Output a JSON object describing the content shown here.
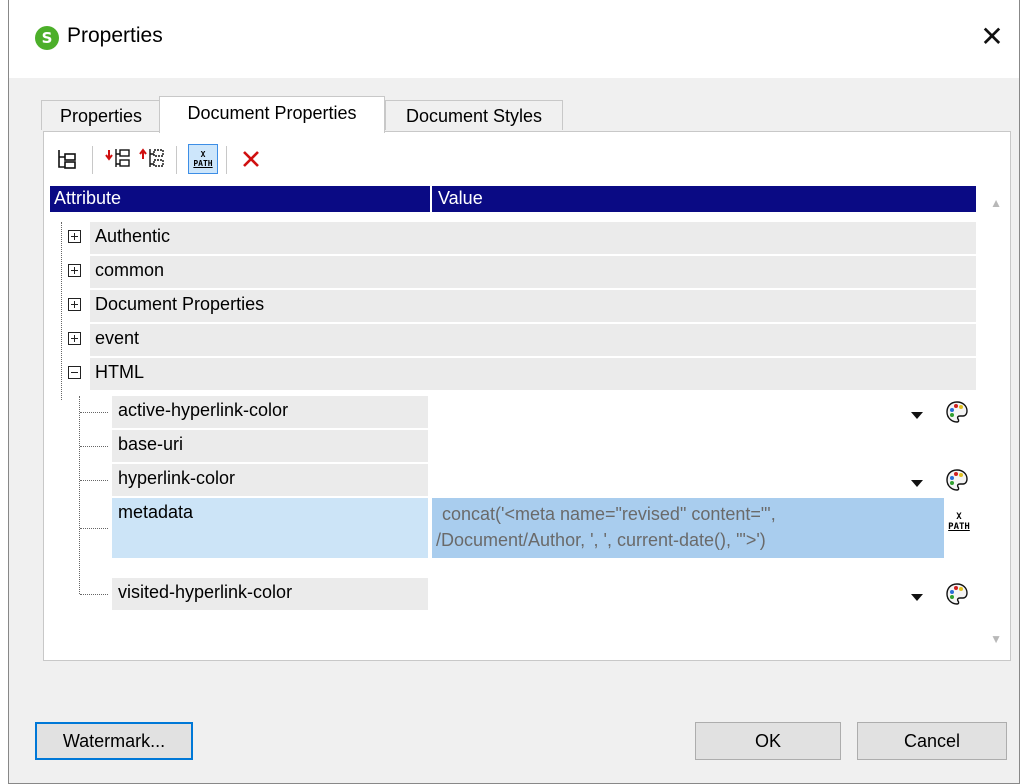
{
  "window": {
    "title": "Properties",
    "app_icon_letter": "S",
    "close_label": "✕"
  },
  "tabs": [
    {
      "label": "Properties",
      "active": false
    },
    {
      "label": "Document Properties",
      "active": true
    },
    {
      "label": "Document Styles",
      "active": false
    }
  ],
  "toolbar": {
    "buttons": [
      {
        "icon": "tree-view-icon"
      },
      {
        "icon": "add-attribute-icon"
      },
      {
        "icon": "add-child-attribute-icon"
      },
      {
        "icon": "xpath-icon",
        "pressed": true,
        "text_top": "X",
        "text_bottom": "PATH"
      },
      {
        "icon": "delete-icon"
      }
    ]
  },
  "grid": {
    "header": {
      "attribute": "Attribute",
      "value": "Value"
    },
    "groups": [
      {
        "label": "Authentic",
        "expanded": false
      },
      {
        "label": "common",
        "expanded": false
      },
      {
        "label": "Document Properties",
        "expanded": false
      },
      {
        "label": "event",
        "expanded": false
      },
      {
        "label": "HTML",
        "expanded": true
      }
    ],
    "children": [
      {
        "label": "active-hyperlink-color",
        "value": "",
        "control": "color"
      },
      {
        "label": "base-uri",
        "value": "",
        "control": "none"
      },
      {
        "label": "hyperlink-color",
        "value": "",
        "control": "color"
      },
      {
        "label": "metadata",
        "value_line1": "concat('<meta name=\"revised\" content=\"',",
        "value_line2": "/Document/Author, ', ', current-date(), '\">')",
        "control": "xpath",
        "selected": true
      },
      {
        "label": "visited-hyperlink-color",
        "value": "",
        "control": "color"
      }
    ]
  },
  "footer": {
    "watermark_label": "Watermark...",
    "ok_label": "OK",
    "cancel_label": "Cancel"
  },
  "colors": {
    "header_bg": "#0a0a84",
    "selection_attr": "#cce4f7",
    "selection_value": "#a9cdee",
    "delete_red": "#d01010",
    "app_green": "#4caf2a"
  }
}
